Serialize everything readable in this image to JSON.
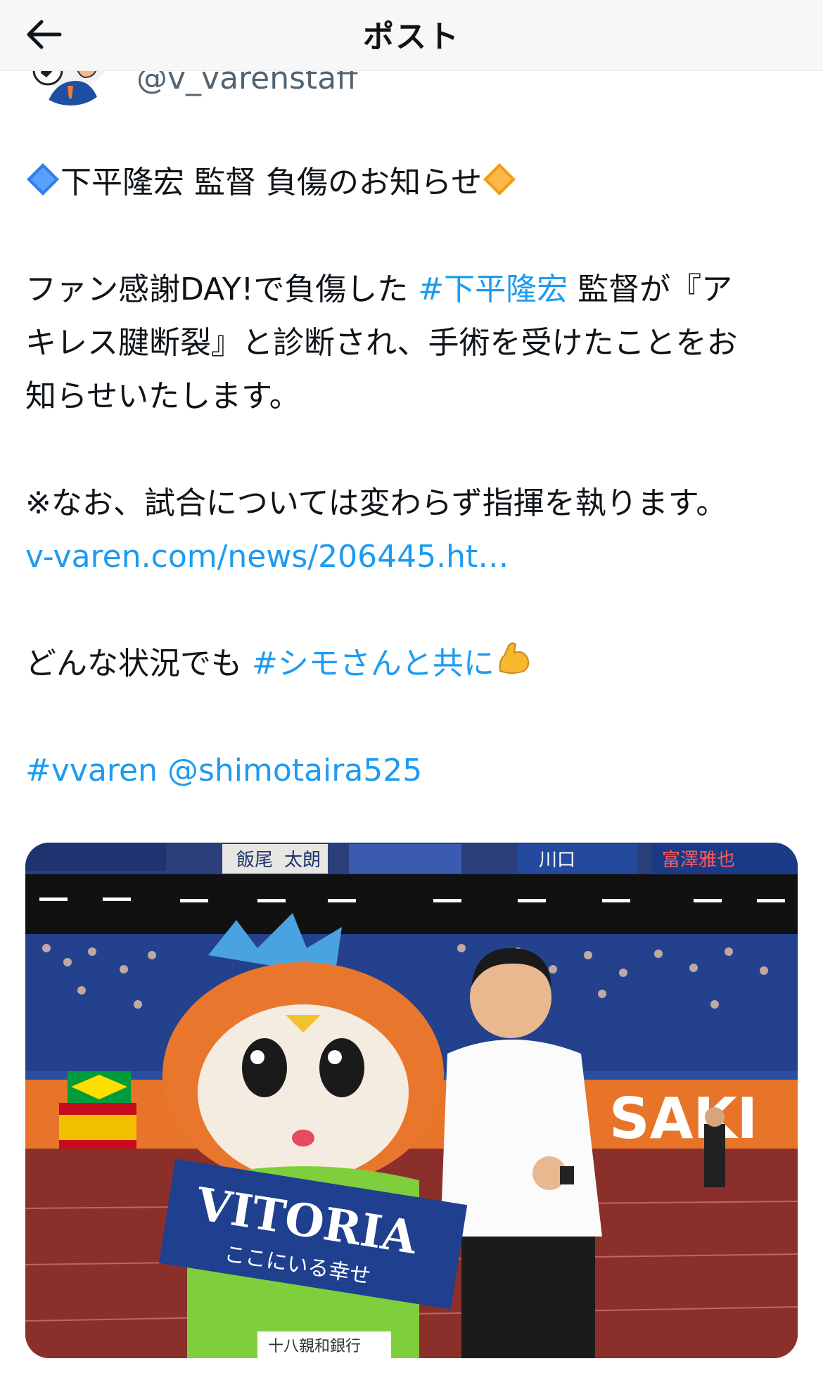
{
  "header": {
    "title": "ポスト",
    "back_icon": "arrow-left-icon"
  },
  "author": {
    "handle": "@v_varenstaff"
  },
  "tweet": {
    "title_text": "下平隆宏 監督 負傷のお知らせ",
    "title_left_emoji": "blue-diamond-icon",
    "title_right_emoji": "orange-diamond-icon",
    "p1_line1_pre": "ファン感謝DAY!で負傷した ",
    "p1_hashtag": "#下平隆宏",
    "p1_line1_post": " 監督が『ア",
    "p1_line2": "キレス腱断裂』と診断され、手術を受けたことをお",
    "p1_line3": "知らせいたします。",
    "p2_line1": "※なお、試合については変わらず指揮を執ります。",
    "p2_link": "v-varen.com/news/206445.ht…",
    "p3_pre": "どんな状況でも ",
    "p3_hashtag": "#シモさんと共に",
    "p3_emoji": "flexed-biceps-icon",
    "tag_vvaren": "#vvaren",
    "mention": "@shimotaira525"
  },
  "media": {
    "banner_texts": [
      "飯尾",
      "太朗",
      "川口",
      "富澤雅也"
    ],
    "towel_text": "VITORIA",
    "towel_subtext": "ここにいる幸せ",
    "sponsor_text": "十八親和銀行",
    "board_text": "SAKI"
  },
  "colors": {
    "link": "#1d9bf0",
    "text": "#0f1419",
    "muted": "#536471"
  }
}
